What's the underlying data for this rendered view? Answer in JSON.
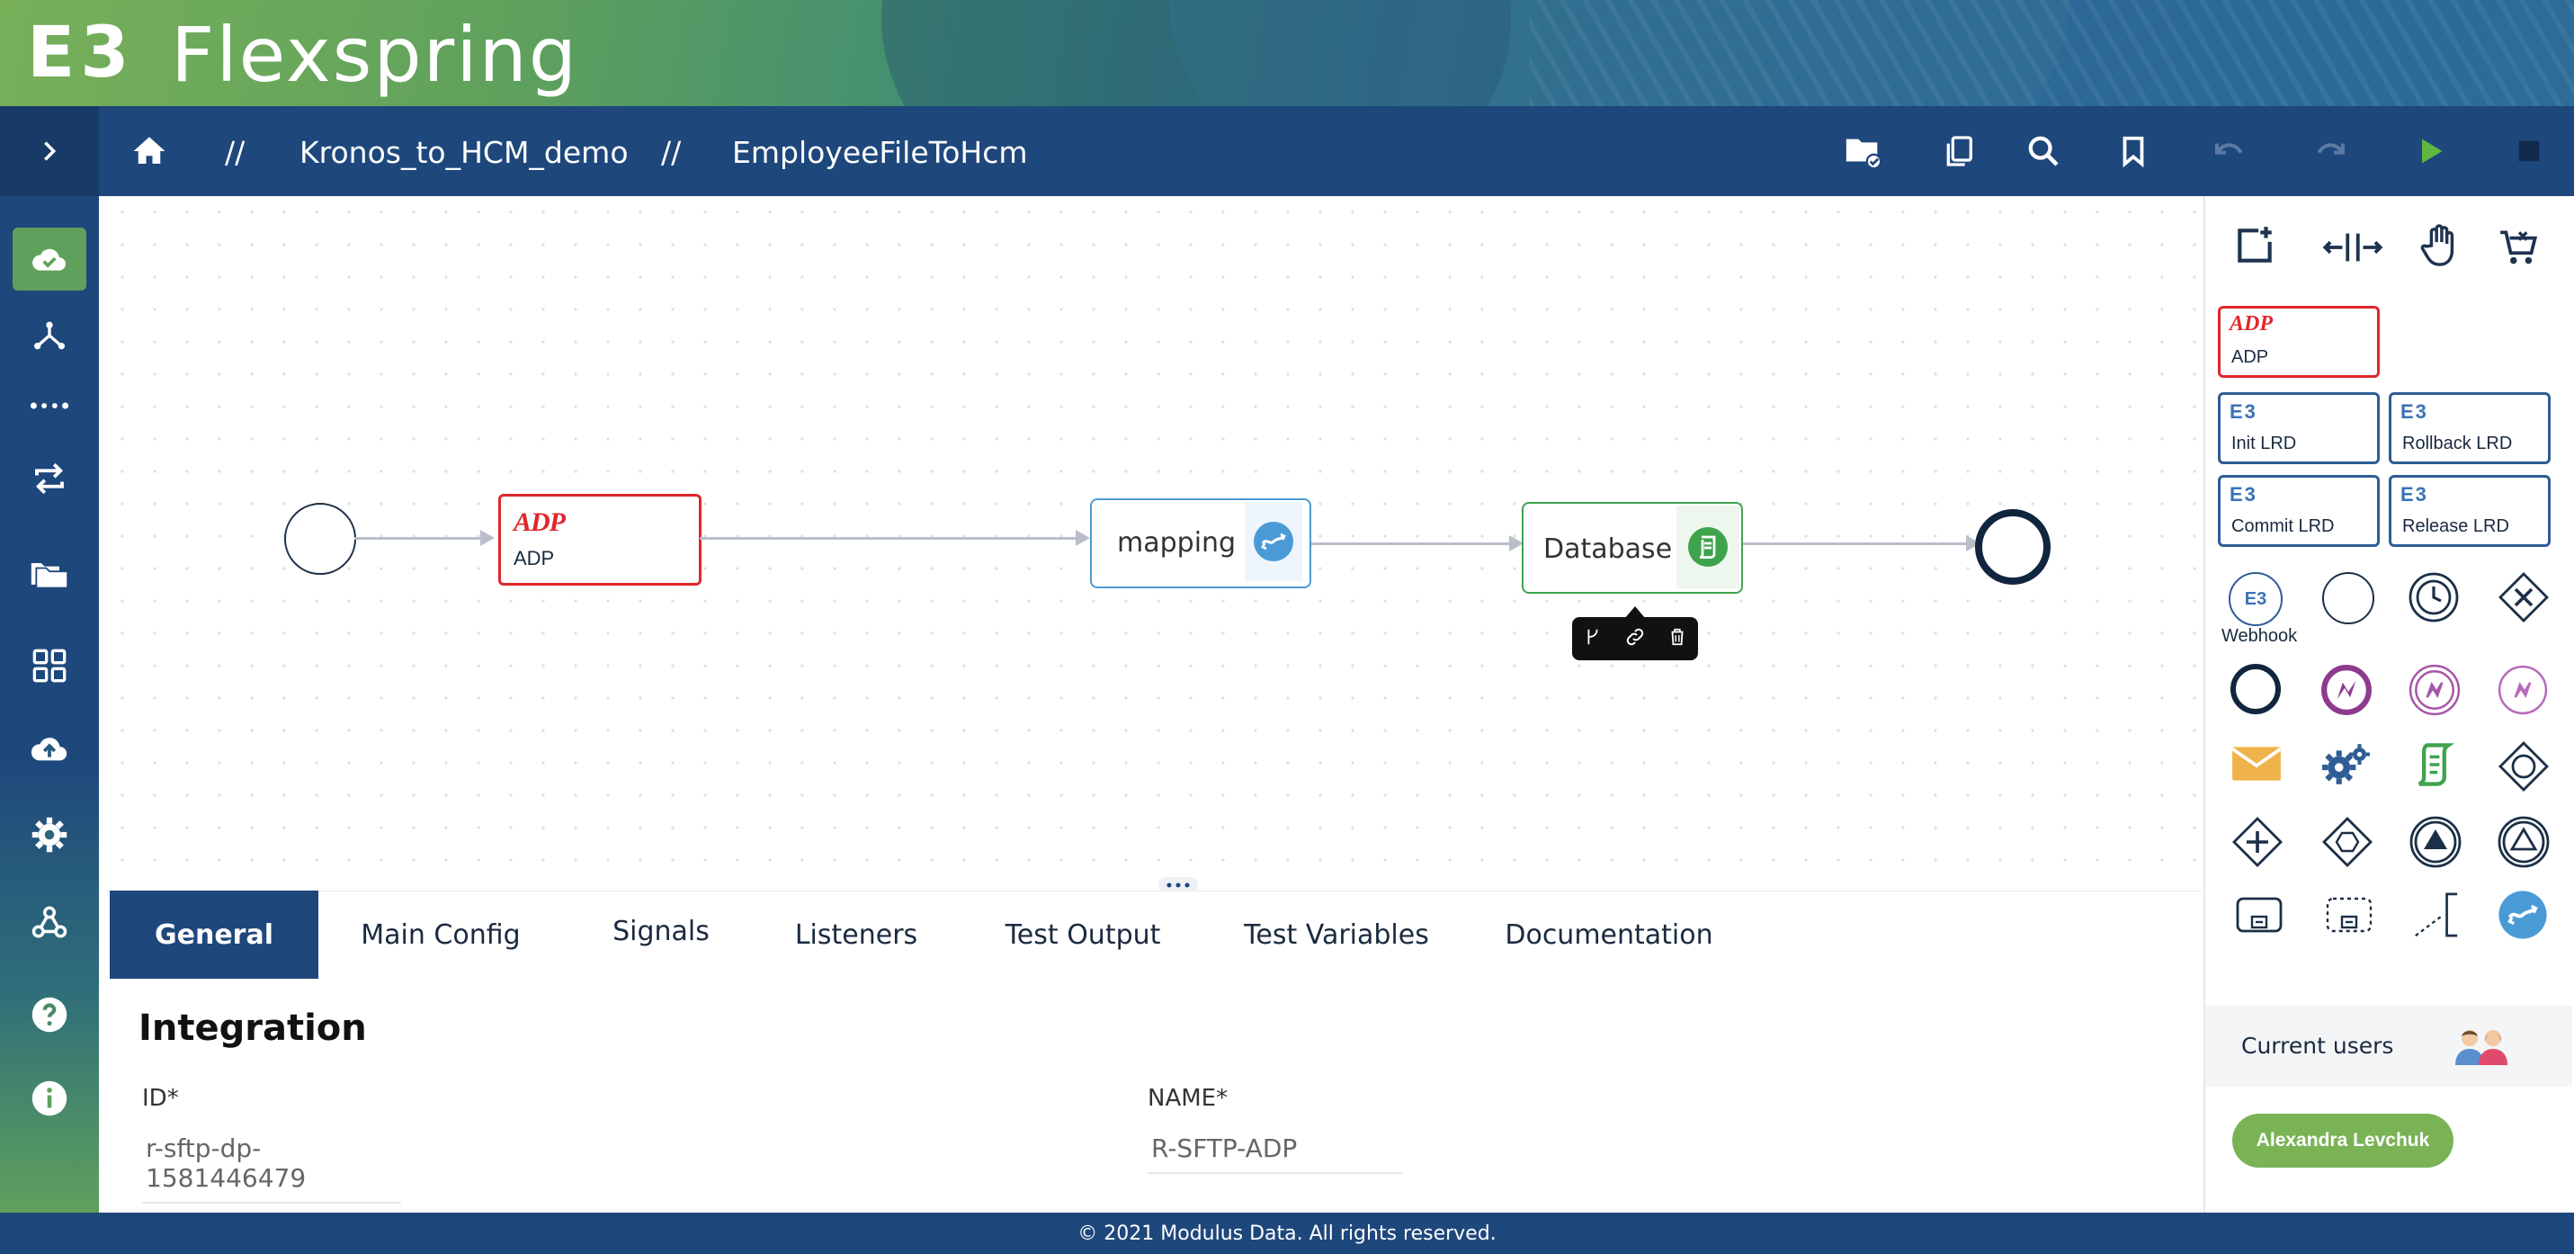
{
  "app": {
    "logo_mark": "E3",
    "name": "Flexspring"
  },
  "breadcrumb": {
    "separator": "//",
    "project": "Kronos_to_HCM_demo",
    "flow": "EmployeeFileToHcm"
  },
  "flow": {
    "adp": {
      "logo": "ADP",
      "label": "ADP"
    },
    "mapping": {
      "label": "mapping"
    },
    "database": {
      "label": "Database"
    }
  },
  "palette": {
    "tiles": [
      {
        "logo": "ADP",
        "label": "ADP"
      },
      {
        "logo": "E3",
        "label": "Init LRD"
      },
      {
        "logo": "E3",
        "label": "Rollback LRD"
      },
      {
        "logo": "E3",
        "label": "Commit LRD"
      },
      {
        "logo": "E3",
        "label": "Release LRD"
      }
    ],
    "webhook": {
      "logo": "E3",
      "label": "Webhook"
    },
    "current_users_label": "Current users",
    "user_name": "Alexandra Levchuk"
  },
  "tabs": [
    "General",
    "Main Config",
    "Signals",
    "Listeners",
    "Test Output",
    "Test Variables",
    "Documentation"
  ],
  "general": {
    "heading": "Integration",
    "id_label": "ID*",
    "id_value": "r-sftp-dp-1581446479",
    "name_label": "NAME*",
    "name_value": "R-SFTP-ADP"
  },
  "footer": "© 2021 Modulus Data. All rights reserved.",
  "colors": {
    "brand_navy": "#1e477c",
    "adp_red": "#e0272b",
    "mapping_blue": "#4a9ad6",
    "database_green": "#3fa34d",
    "user_badge": "#7ab356"
  }
}
